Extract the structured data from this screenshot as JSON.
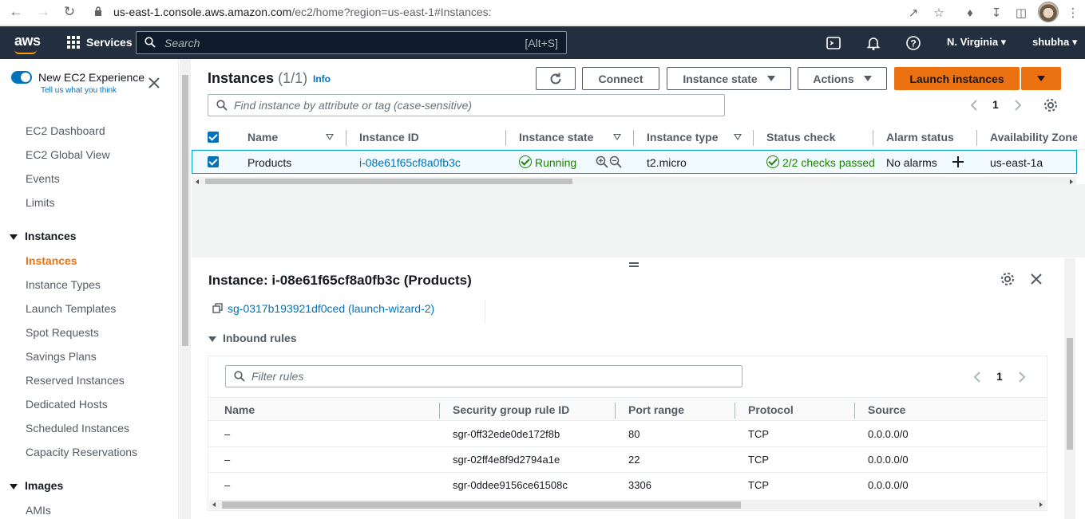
{
  "browser": {
    "url_host": "us-east-1.console.aws.amazon.com",
    "url_path": "/ec2/home?region=us-east-1#Instances:"
  },
  "header": {
    "logo": "aws",
    "services_label": "Services",
    "search_placeholder": "Search",
    "search_shortcut": "[Alt+S]",
    "region": "N. Virginia",
    "user": "shubha"
  },
  "sidebar": {
    "new_experience_label": "New EC2 Experience",
    "tell_us": "Tell us what you think",
    "items_top": [
      "EC2 Dashboard",
      "EC2 Global View",
      "Events",
      "Limits"
    ],
    "section_instances": "Instances",
    "instances_items": [
      "Instances",
      "Instance Types",
      "Launch Templates",
      "Spot Requests",
      "Savings Plans",
      "Reserved Instances",
      "Dedicated Hosts",
      "Scheduled Instances",
      "Capacity Reservations"
    ],
    "active_item": "Instances",
    "section_images": "Images",
    "images_items": [
      "AMIs"
    ]
  },
  "instances_panel": {
    "title": "Instances",
    "count": "(1/1)",
    "info": "Info",
    "buttons": {
      "connect": "Connect",
      "instance_state": "Instance state",
      "actions": "Actions",
      "launch": "Launch instances"
    },
    "search_placeholder": "Find instance by attribute or tag (case-sensitive)",
    "page": "1",
    "columns": [
      "Name",
      "Instance ID",
      "Instance state",
      "Instance type",
      "Status check",
      "Alarm status",
      "Availability Zone"
    ],
    "rows": [
      {
        "name": "Products",
        "instance_id": "i-08e61f65cf8a0fb3c",
        "state": "Running",
        "type": "t2.micro",
        "status_check": "2/2 checks passed",
        "alarm_status": "No alarms",
        "az": "us-east-1a"
      }
    ]
  },
  "details": {
    "title": "Instance: i-08e61f65cf8a0fb3c (Products)",
    "security_group": "sg-0317b193921df0ced (launch-wizard-2)",
    "inbound_label": "Inbound rules",
    "filter_placeholder": "Filter rules",
    "page": "1",
    "columns": [
      "Name",
      "Security group rule ID",
      "Port range",
      "Protocol",
      "Source"
    ],
    "rules": [
      {
        "name": "–",
        "id": "sgr-0ff32ede0de172f8b",
        "port": "80",
        "protocol": "TCP",
        "source": "0.0.0.0/0"
      },
      {
        "name": "–",
        "id": "sgr-02ff4e8f9d2794a1e",
        "port": "22",
        "protocol": "TCP",
        "source": "0.0.0.0/0"
      },
      {
        "name": "–",
        "id": "sgr-0ddee9156ce61508c",
        "port": "3306",
        "protocol": "TCP",
        "source": "0.0.0.0/0"
      }
    ]
  },
  "colors": {
    "aws_header": "#232f3e",
    "accent_orange": "#ec7211",
    "link_blue": "#0073bb",
    "success_green": "#1d8102"
  }
}
